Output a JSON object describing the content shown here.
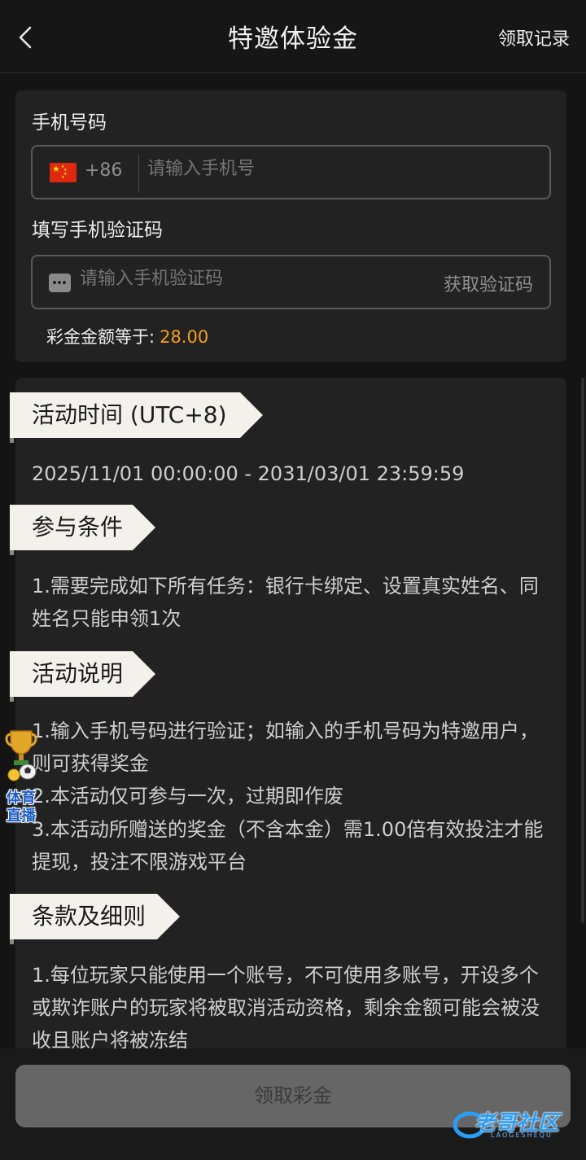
{
  "header": {
    "title": "特邀体验金",
    "right_link": "领取记录",
    "back_icon": "chevron-left-icon"
  },
  "form": {
    "phone_label": "手机号码",
    "country_flag": "china-flag-icon",
    "dial_code": "+86",
    "phone_placeholder": "请输入手机号",
    "phone_value": "",
    "code_label": "填写手机验证码",
    "sms_icon": "message-dots-icon",
    "code_placeholder": "请输入手机验证码",
    "code_value": "",
    "get_code_label": "获取验证码",
    "bonus_label": "彩金金额等于:",
    "bonus_amount": "28.00",
    "bonus_color": "#f4a01c"
  },
  "sections": [
    {
      "title": "活动时间 (UTC+8)",
      "lines": [
        "2025/11/01 00:00:00 - 2031/03/01 23:59:59"
      ]
    },
    {
      "title": "参与条件",
      "lines": [
        "1.需要完成如下所有任务：银行卡绑定、设置真实姓名、同姓名只能申领1次"
      ]
    },
    {
      "title": "活动说明",
      "lines": [
        "1.输入手机号码进行验证；如输入的手机号码为特邀用户，则可获得奖金",
        "2.本活动仅可参与一次，过期即作废",
        "3.本活动所赠送的奖金（不含本金）需1.00倍有效投注才能提现，投注不限游戏平台"
      ]
    },
    {
      "title": "条款及细则",
      "lines": [
        "1.每位玩家只能使用一个账号，不可使用多账号，开设多个或欺诈账户的玩家将被取消活动资格，剩余金额可能会被没收且账户将被冻结"
      ]
    }
  ],
  "float_widget": {
    "icon": "trophy-icon",
    "line1": "体育",
    "line2": "直播"
  },
  "bottom": {
    "claim_button": "领取彩金"
  },
  "watermark": {
    "text": "老哥社区",
    "sub": "LAOGESHEQU"
  }
}
